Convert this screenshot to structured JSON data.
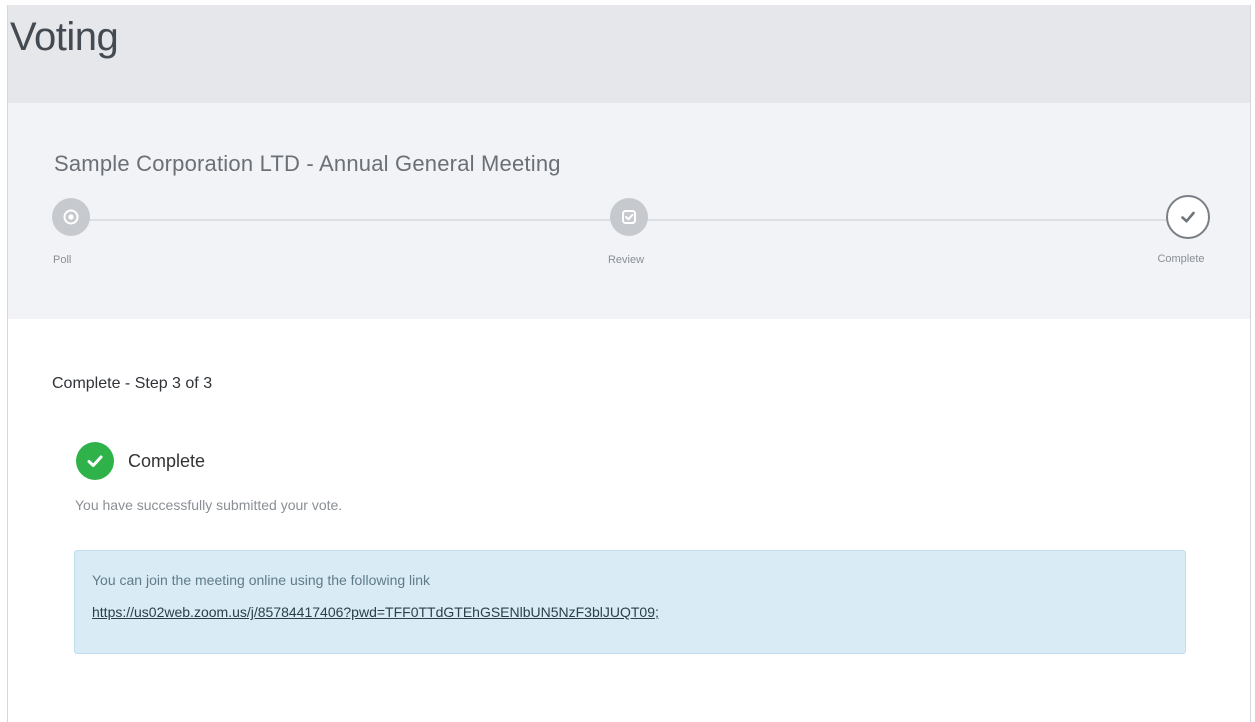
{
  "header": {
    "title": "Voting"
  },
  "meeting": {
    "title": "Sample Corporation LTD - Annual General Meeting"
  },
  "stepper": {
    "steps": [
      {
        "label": "Poll",
        "icon": "radio-target-icon",
        "state": "inactive"
      },
      {
        "label": "Review",
        "icon": "check-square-icon",
        "state": "inactive"
      },
      {
        "label": "Complete",
        "icon": "check-icon",
        "state": "complete"
      }
    ]
  },
  "content": {
    "step_heading": "Complete - Step 3 of 3",
    "status_label": "Complete",
    "status_icon": "check-circle-icon",
    "status_color": "#2fb24a",
    "success_message": "You have successfully submitted your vote.",
    "info_text": "You can join the meeting online using the following link",
    "meeting_link": "https://us02web.zoom.us/j/85784417406?pwd=TFF0TTdGTEhGSENlbUN5NzF3blJUQT09;"
  }
}
